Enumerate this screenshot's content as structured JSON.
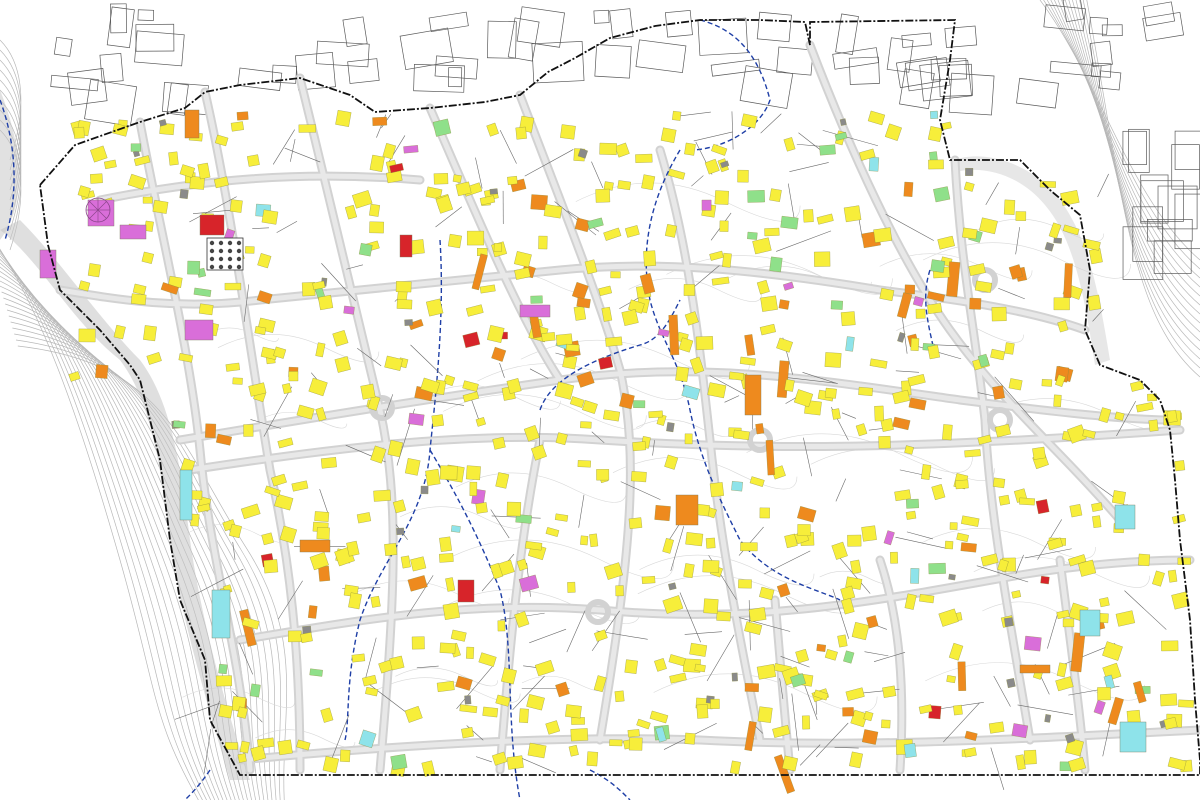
{
  "map": {
    "kind": "urban land-use / building survey plan",
    "legend_colors": {
      "residential": "#f7ee3a",
      "commercial": "#ee8a1e",
      "public": "#d7242a",
      "religious": "#d96ed9",
      "green": "#8fe08a",
      "utility": "#8ee3ea",
      "ruin": "#8a8a8a",
      "road": "#d2d2d2",
      "boundary": "#111111",
      "stream": "#1f3fa6",
      "contour": "#b8b8b8",
      "context_buildings": "#5a5a5a"
    },
    "icons": [
      "mosque-courtyard-icon",
      "circular-plaza-icon"
    ]
  }
}
